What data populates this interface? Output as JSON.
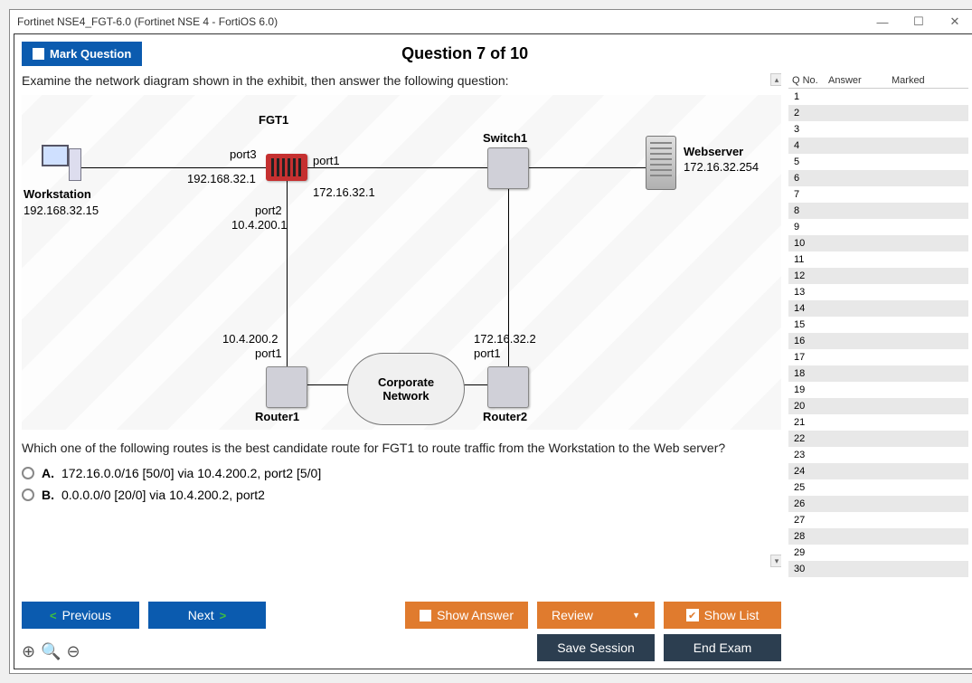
{
  "window": {
    "title": "Fortinet NSE4_FGT-6.0 (Fortinet NSE 4 - FortiOS 6.0)"
  },
  "header": {
    "mark_label": "Mark Question",
    "q_title": "Question 7 of 10"
  },
  "question": {
    "intro": "Examine the network diagram shown in the exhibit, then answer the following question:",
    "followup": "Which one of the following routes is the best candidate route for FGT1 to route traffic from the Workstation to the Web server?"
  },
  "options": {
    "a_prefix": "A.",
    "a_text": "172.16.0.0/16 [50/0] via 10.4.200.2, port2 [5/0]",
    "b_prefix": "B.",
    "b_text": "0.0.0.0/0 [20/0] via 10.4.200.2, port2"
  },
  "diagram": {
    "fgt1": "FGT1",
    "switch1": "Switch1",
    "webserver": "Webserver",
    "webserver_ip": "172.16.32.254",
    "workstation": "Workstation",
    "workstation_ip": "192.168.32.15",
    "port3": "port3",
    "port3_ip": "192.168.32.1",
    "port1": "port1",
    "port1_ip": "172.16.32.1",
    "port2": "port2",
    "port2_ip": "10.4.200.1",
    "r1_ip": "10.4.200.2",
    "r1_port": "port1",
    "router1": "Router1",
    "r2_ip": "172.16.32.2",
    "r2_port": "port1",
    "router2": "Router2",
    "cloud1": "Corporate",
    "cloud2": "Network"
  },
  "sidebar": {
    "col1": "Q No.",
    "col2": "Answer",
    "col3": "Marked",
    "rows": [
      "1",
      "2",
      "3",
      "4",
      "5",
      "6",
      "7",
      "8",
      "9",
      "10",
      "11",
      "12",
      "13",
      "14",
      "15",
      "16",
      "17",
      "18",
      "19",
      "20",
      "21",
      "22",
      "23",
      "24",
      "25",
      "26",
      "27",
      "28",
      "29",
      "30"
    ]
  },
  "footer": {
    "prev": "Previous",
    "next": "Next",
    "show_answer": "Show Answer",
    "review": "Review",
    "show_list": "Show List",
    "save": "Save Session",
    "end": "End Exam"
  }
}
